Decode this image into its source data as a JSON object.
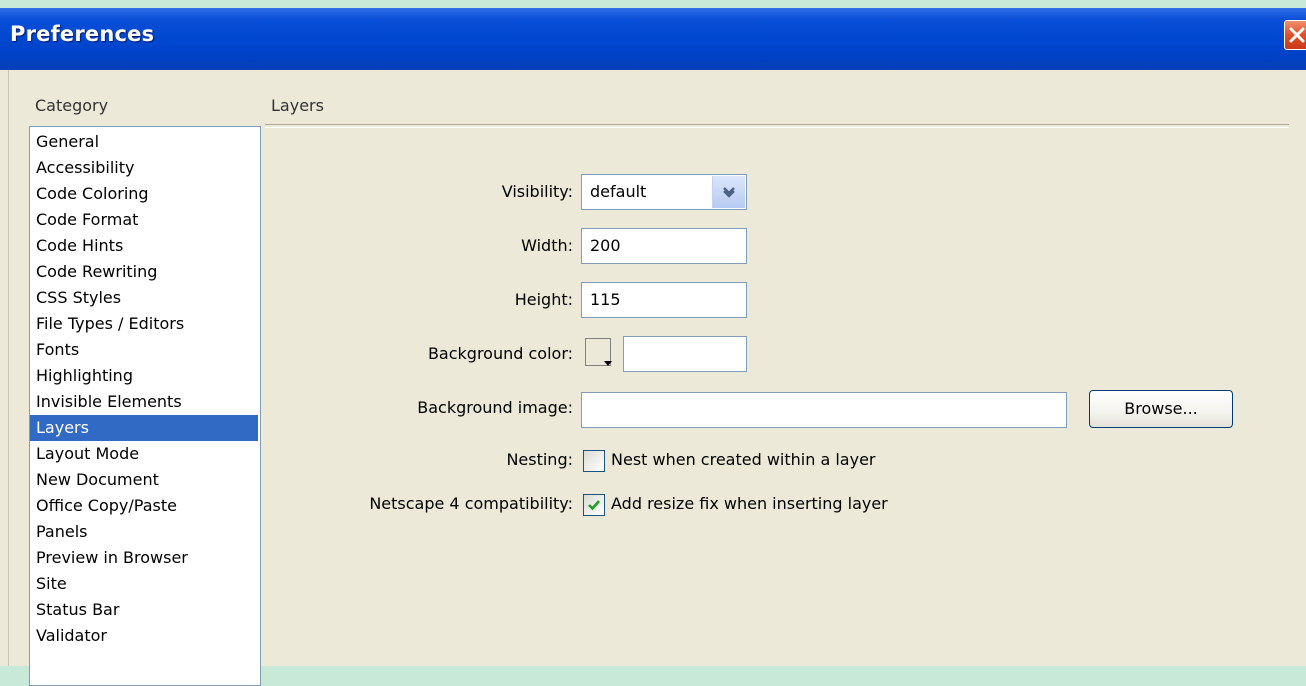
{
  "window": {
    "title": "Preferences"
  },
  "category_header": "Category",
  "section_title": "Layers",
  "categories": [
    "General",
    "Accessibility",
    "Code Coloring",
    "Code Format",
    "Code Hints",
    "Code Rewriting",
    "CSS Styles",
    "File Types / Editors",
    "Fonts",
    "Highlighting",
    "Invisible Elements",
    "Layers",
    "Layout Mode",
    "New Document",
    "Office Copy/Paste",
    "Panels",
    "Preview in Browser",
    "Site",
    "Status Bar",
    "Validator"
  ],
  "selected_category": "Layers",
  "form": {
    "visibility_label": "Visibility:",
    "visibility_value": "default",
    "width_label": "Width:",
    "width_value": "200",
    "height_label": "Height:",
    "height_value": "115",
    "bgcolor_label": "Background color:",
    "bgcolor_value": "",
    "bgimage_label": "Background image:",
    "bgimage_value": "",
    "browse_label": "Browse...",
    "nesting_label": "Nesting:",
    "nesting_option": "Nest when created within a layer",
    "nesting_checked": false,
    "ns4_label": "Netscape 4 compatibility:",
    "ns4_option": "Add resize fix when inserting layer",
    "ns4_checked": true
  },
  "colors": {
    "titlebar": "#0047d0",
    "selection": "#316ac5",
    "dialog_bg": "#ece9d8",
    "desktop_bg": "#c8e8d8"
  }
}
